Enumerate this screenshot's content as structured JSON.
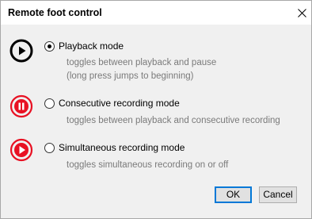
{
  "window": {
    "title": "Remote foot control",
    "close_icon": "close-icon"
  },
  "modes": [
    {
      "label": "Playback mode",
      "description_lines": [
        "toggles between playback and pause",
        "(long press jumps to beginning)"
      ],
      "selected": true,
      "icon": "play-icon",
      "icon_color": "#000000"
    },
    {
      "label": "Consecutive recording mode",
      "description_lines": [
        "toggles between playback and consecutive recording"
      ],
      "selected": false,
      "icon": "pause-record-icon",
      "icon_color": "#e81123"
    },
    {
      "label": "Simultaneous recording mode",
      "description_lines": [
        "toggles simultaneous recording on or off"
      ],
      "selected": false,
      "icon": "play-record-icon",
      "icon_color": "#e81123"
    }
  ],
  "buttons": {
    "ok_label": "OK",
    "cancel_label": "Cancel"
  },
  "colors": {
    "accent": "#0078d7",
    "record_red": "#e81123",
    "description_gray": "#7a7a7a"
  }
}
